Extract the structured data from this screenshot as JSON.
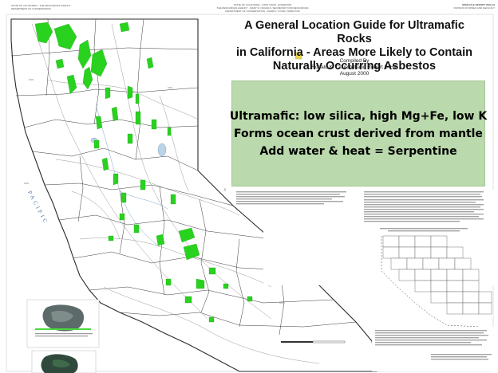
{
  "header": {
    "left_agency": "STATE OF CALIFORNIA - THE RESOURCES AGENCY",
    "left_dept": "DEPARTMENT OF CONSERVATION",
    "center_line1": "STATE OF CALIFORNIA - GRAY DAVIS, GOVERNOR",
    "center_line2": "THE RESOURCES AGENCY - MARY D. NICHOLS, SECRETARY FOR RESOURCES",
    "center_line3": "DEPARTMENT OF CONSERVATION - DARRYL YOUNG, DIRECTOR",
    "right_line1": "OPEN-FILE REPORT 2000-19",
    "right_line2": "DIVISION OF MINES AND GEOLOGY"
  },
  "title": {
    "line1": "A General Location Guide for Ultramafic Rocks",
    "line2": "in California - Areas More Likely to Contain",
    "line3": "Naturally Occurring Asbestos"
  },
  "compiled": {
    "label": "Compiled By",
    "authors": "Ronald K. Churchill and Robert L. Hill",
    "date": "August 2000"
  },
  "callout": {
    "line1": "Ultramafic: low silica, high Mg+Fe, low K",
    "line2": "Forms ocean crust derived from mantle",
    "line3": "Add water & heat = Serpentine"
  },
  "map": {
    "ocean_label": "PACIFIC",
    "colors": {
      "ultramafic": "#29d21f",
      "outline": "#2b2b2b",
      "roads": "#9a9a9a",
      "callout_bg": "#bad9ac"
    }
  }
}
